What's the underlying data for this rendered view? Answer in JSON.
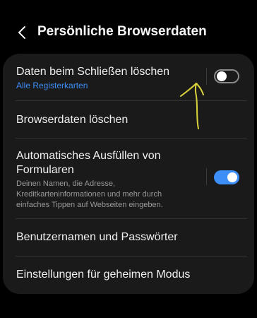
{
  "header": {
    "title": "Persönliche Browserdaten",
    "back_icon": "chevron-left-icon"
  },
  "settings": {
    "clear_on_close": {
      "title": "Daten beim Schließen löschen",
      "subtitle": "Alle Registerkarten",
      "enabled": false
    },
    "clear_data": {
      "title": "Browserdaten löschen"
    },
    "autofill": {
      "title_line1": "Automatisches Ausfüllen von",
      "title_line2": "Formularen",
      "desc_line1": "Deinen Namen, die Adresse,",
      "desc_line2": "Kreditkarteninformationen und mehr durch",
      "desc_line3": "einfaches Tippen auf Webseiten eingeben.",
      "enabled": true
    },
    "passwords": {
      "title": "Benutzernamen und Passwörter"
    },
    "secret_mode": {
      "title": "Einstellungen für geheimen Modus"
    }
  },
  "colors": {
    "accent": "#3e8ef7",
    "background": "#000000",
    "card": "#1a1a1a",
    "annotation": "#d9d23a"
  }
}
